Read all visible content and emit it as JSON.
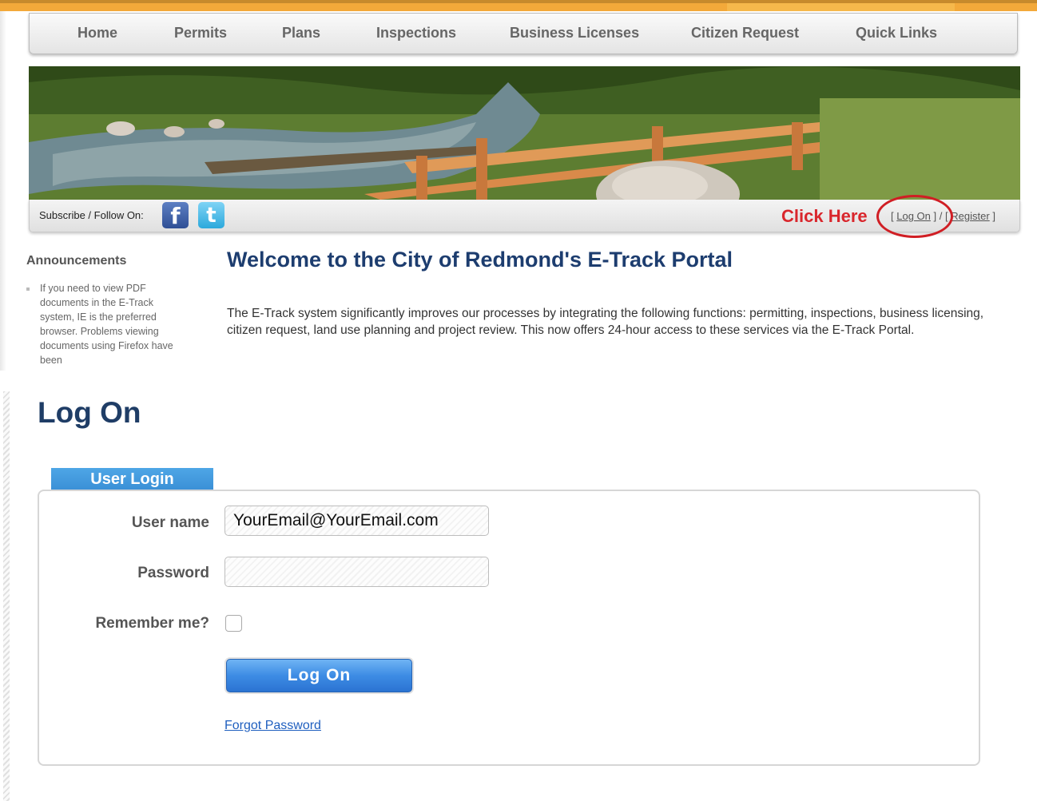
{
  "nav": {
    "items": [
      "Home",
      "Permits",
      "Plans",
      "Inspections",
      "Business Licenses",
      "Citizen Request",
      "Quick Links"
    ]
  },
  "social": {
    "subscribe_label": "Subscribe / Follow On:",
    "facebook_glyph": "f",
    "twitter_glyph": "t",
    "click_here": "Click Here",
    "log_on_link": "Log On",
    "register_link": "Register",
    "bracket_open": "[",
    "bracket_close": "]",
    "separator": "/"
  },
  "announcements": {
    "title": "Announcements",
    "items": [
      "If you need to view PDF documents in the E-Track system, IE is the preferred browser. Problems viewing documents using Firefox have been"
    ]
  },
  "welcome": {
    "title": "Welcome to the City of Redmond's E-Track Portal",
    "text": "The E-Track system significantly improves our processes by integrating the following functions: permitting, inspections, business licensing, citizen request, land use planning and project review.  This now offers 24-hour access to these services via the E-Track Portal."
  },
  "logon": {
    "title": "Log On",
    "tab_label": "User Login",
    "username_label": "User name",
    "username_value": "YourEmail@YourEmail.com",
    "password_label": "Password",
    "password_value": "",
    "remember_label": "Remember me?",
    "remember_checked": false,
    "submit_label": "Log On",
    "forgot_link": "Forgot Password"
  },
  "colors": {
    "accent_orange": "#f3a93a",
    "title_navy": "#1d3d6f",
    "click_here_red": "#d9262c",
    "button_blue": "#3d8ce4"
  }
}
